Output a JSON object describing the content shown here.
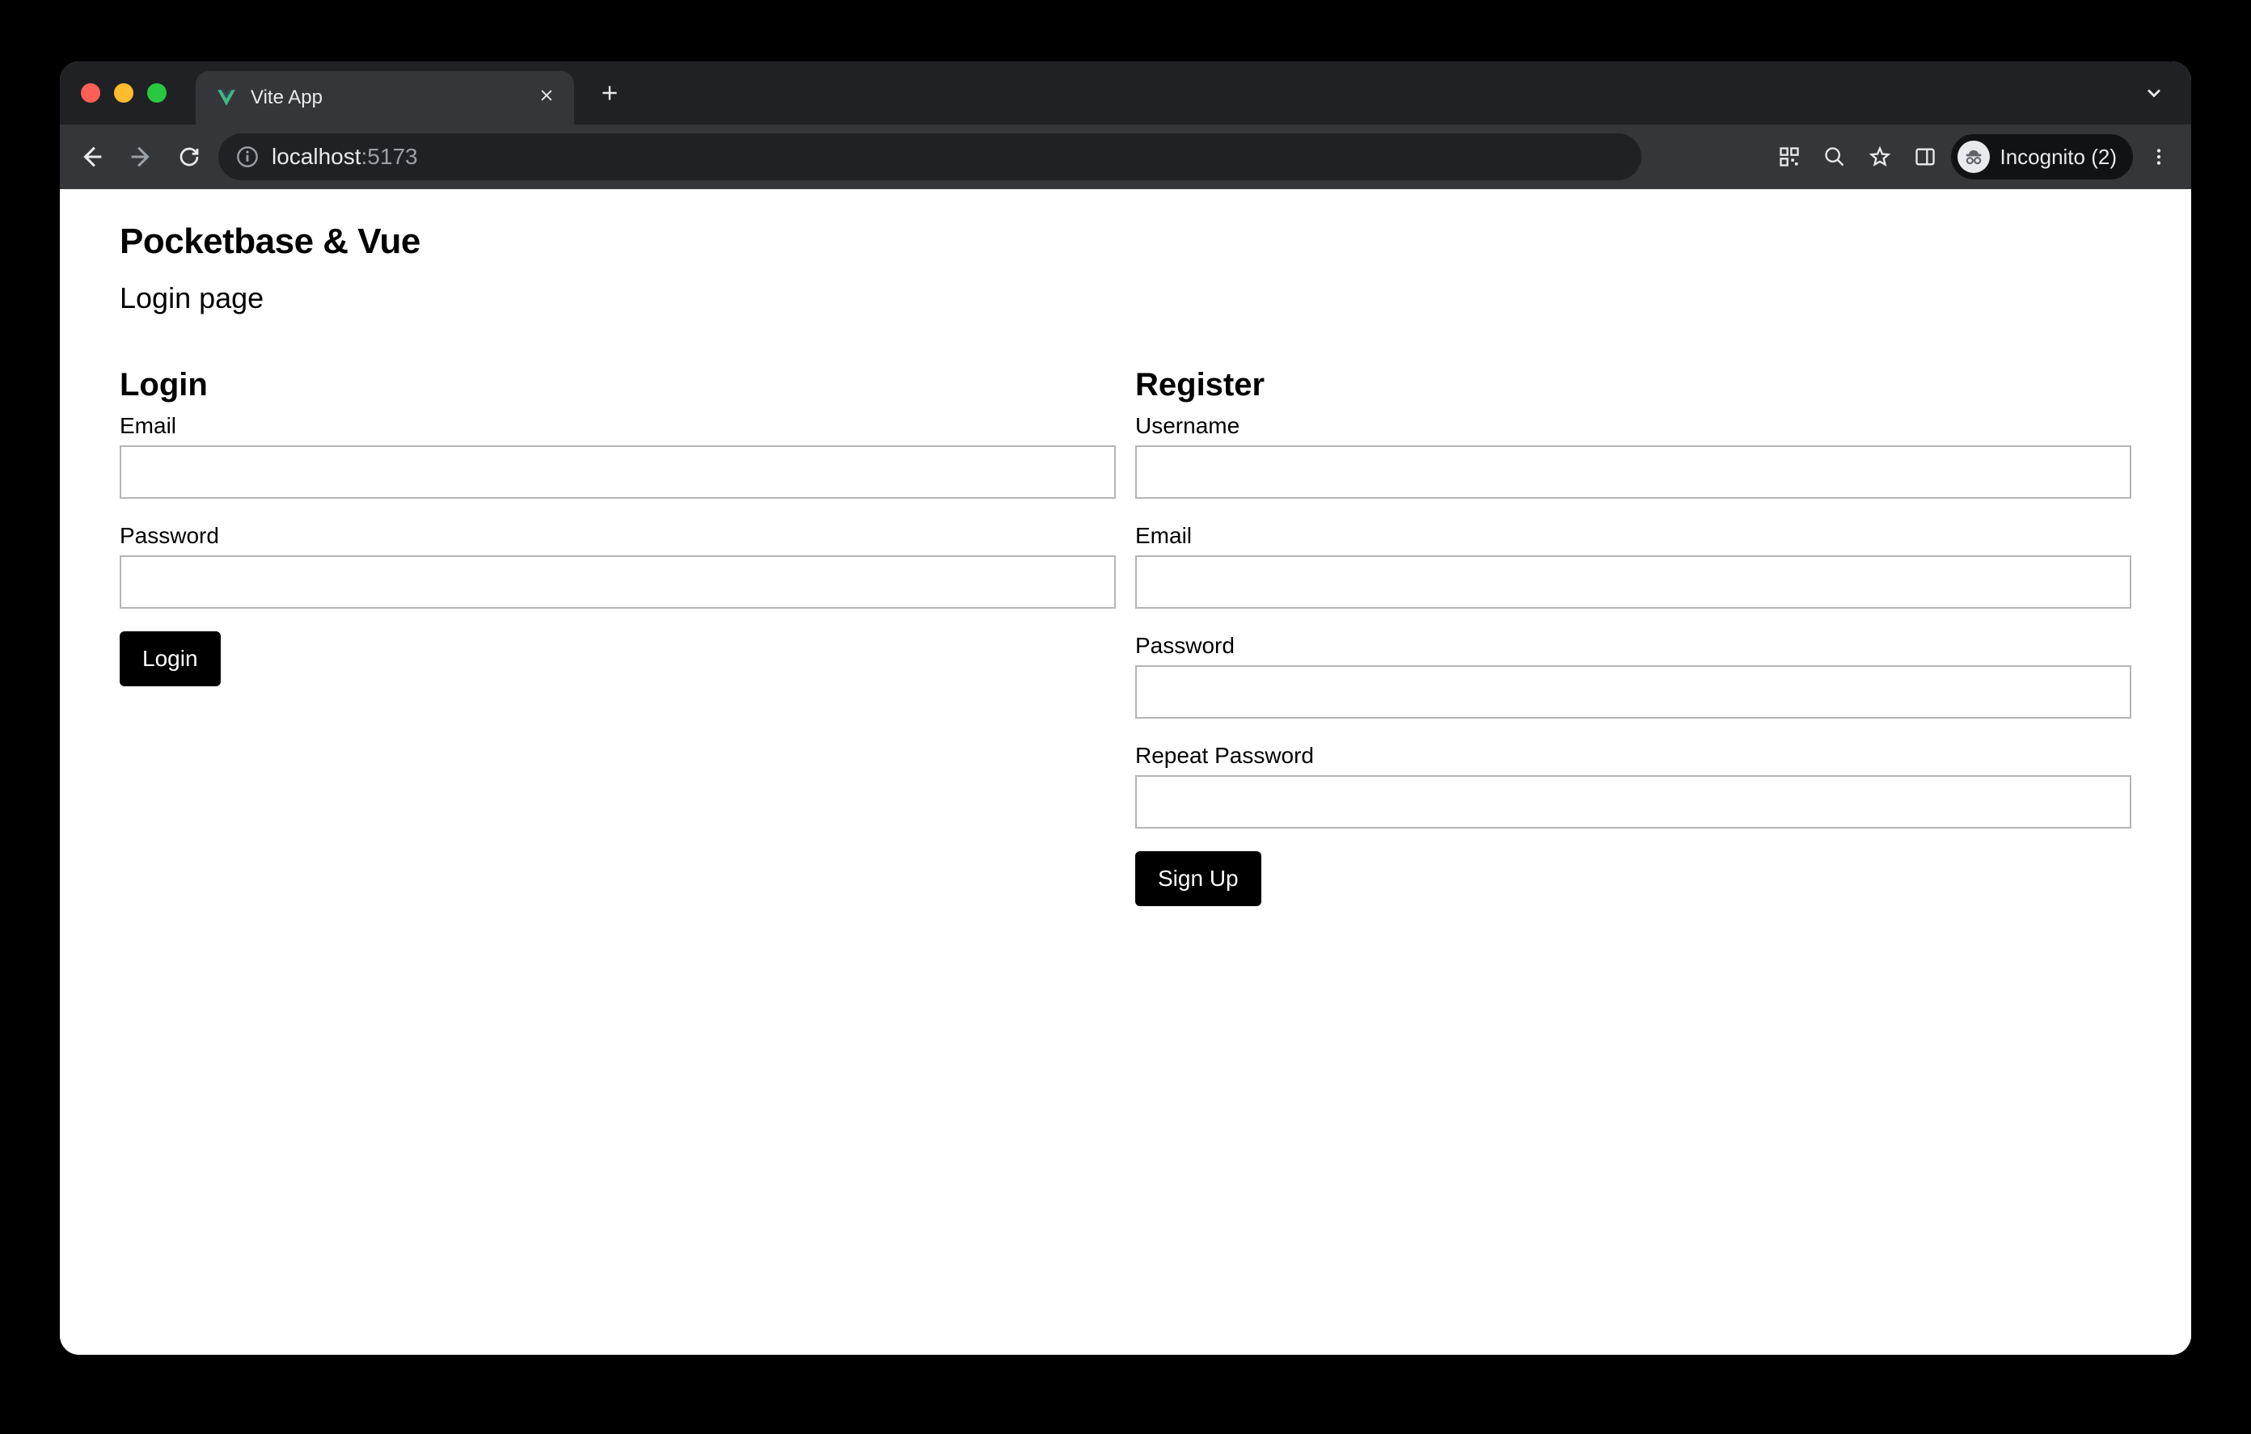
{
  "browser": {
    "tab_title": "Vite App",
    "url_host": "localhost",
    "url_port": ":5173",
    "incognito_label": "Incognito (2)"
  },
  "page": {
    "title": "Pocketbase & Vue",
    "subtitle": "Login page",
    "login": {
      "heading": "Login",
      "email_label": "Email",
      "password_label": "Password",
      "button": "Login"
    },
    "register": {
      "heading": "Register",
      "username_label": "Username",
      "email_label": "Email",
      "password_label": "Password",
      "repeat_password_label": "Repeat Password",
      "button": "Sign Up"
    }
  }
}
